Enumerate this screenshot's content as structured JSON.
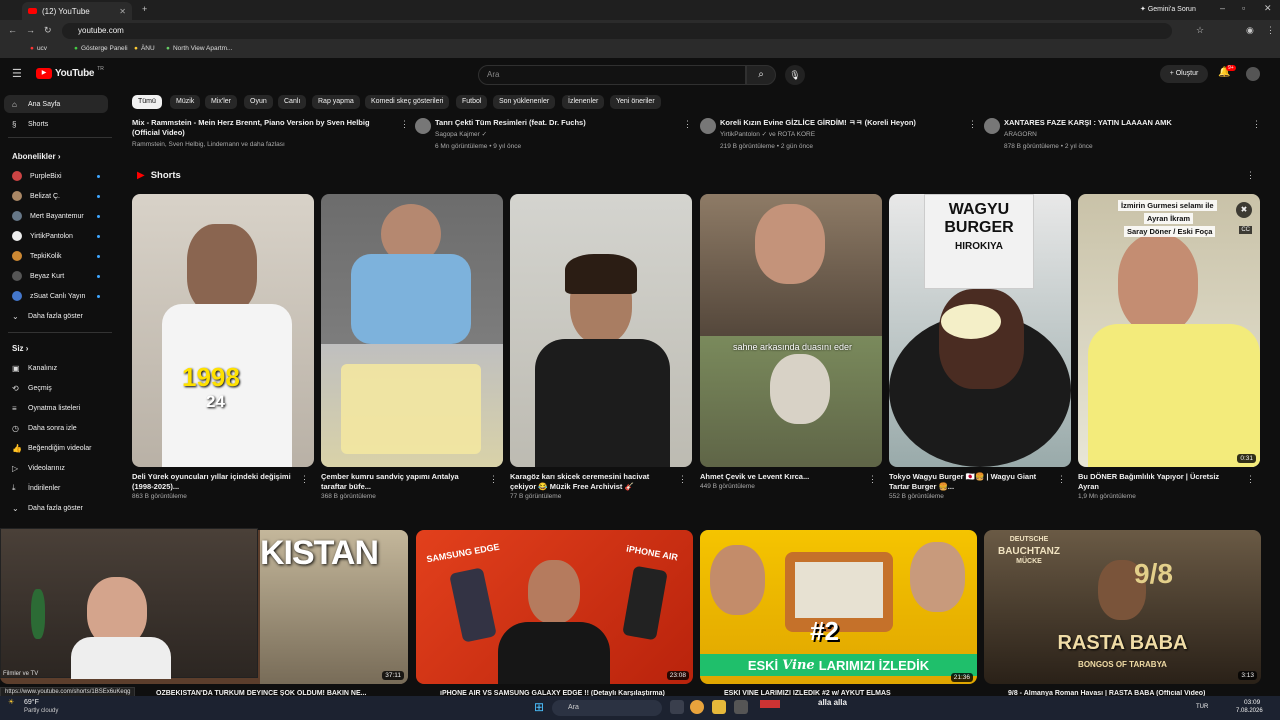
{
  "browser": {
    "tab_title": "(12) YouTube",
    "url": "youtube.com",
    "gemini": "Gemini'a Sorun",
    "bookmarks": [
      "ucv",
      "Gösterge Paneli",
      "ÄNU",
      "North View Apartm..."
    ]
  },
  "header": {
    "logo": "YouTube",
    "logo_sup": "TR",
    "search_placeholder": "Ara",
    "create": "Oluştur",
    "notif": "9+"
  },
  "sidebar": {
    "home": "Ana Sayfa",
    "shorts": "Shorts",
    "subs_head": "Abonelikler",
    "subs": [
      {
        "label": "PurpleBixi",
        "color": "#c44"
      },
      {
        "label": "Belizat Ç.",
        "color": "#a86"
      },
      {
        "label": "Mert Bayantemur",
        "color": "#678"
      },
      {
        "label": "YirtikPantolon",
        "color": "#eee"
      },
      {
        "label": "TepkiKolik",
        "color": "#c83"
      },
      {
        "label": "Beyaz Kurt",
        "color": "#555"
      },
      {
        "label": "zSuat Canlı Yayın",
        "color": "#47c"
      }
    ],
    "more": "Daha fazla göster",
    "you_head": "Siz",
    "you": [
      "Kanalınız",
      "Geçmiş",
      "Oynatma listeleri",
      "Daha sonra izle",
      "Beğendiğim videolar",
      "Videolarınız",
      "İndirilenler",
      "Daha fazla göster"
    ]
  },
  "chips": [
    "Tümü",
    "Müzik",
    "Mix'ler",
    "Oyun",
    "Canlı",
    "Rap yapma",
    "Komedi skeç gösterileri",
    "Futbol",
    "Son yüklenenler",
    "İzlenenler",
    "Yeni öneriler"
  ],
  "toprow": [
    {
      "title": "Mix - Rammstein - Mein Herz Brennt, Piano Version by Sven Helbig",
      "title2": "(Official Video)",
      "meta": "Rammstein, Sven Helbig, Lindemann ve daha fazlası"
    },
    {
      "title": "Tanrı Çekti Tüm Resimleri (feat. Dr. Fuchs)",
      "channel": "Sagopa Kajmer ✓",
      "meta": "6 Mn görüntüleme • 9 yıl önce"
    },
    {
      "title": "Koreli Kızın Evine GİZLİCE GİRDİM! ㅋㅋ (Koreli Heyon)",
      "channel": "YirtikPantolon ✓ ve ROTA KORE",
      "meta": "219 B görüntüleme • 2 gün önce"
    },
    {
      "title": "XANTARES FAZE KARŞI : YATIN LAAAAN AMK",
      "channel": "ARAGORN",
      "meta": "878 B görüntüleme • 2 yıl önce"
    }
  ],
  "shorts_head": "Shorts",
  "shorts": [
    {
      "title": "Deli Yürek oyuncuları yıllar içindeki değişimi (1998-2025)...",
      "views": "863 B görüntüleme",
      "overlay1": "1998",
      "overlay2": "24"
    },
    {
      "title": "Çember kumru sandviç yapımı Antalya taraftar büfe...",
      "views": "368 B görüntüleme"
    },
    {
      "title": "Karagöz karı skicek ceremesini hacivat çekiyor 😂 Müzik Free Archivist 🎸",
      "views": "77 B görüntüleme"
    },
    {
      "title": "Ahmet Çevik ve Levent Kırca...",
      "views": "449 B görüntüleme",
      "caption": "sahne arkasında duasını eder"
    },
    {
      "title": "Tokyo Wagyu Burger 🇯🇵🍔 | Wagyu Giant Tartar Burger 🍔...",
      "views": "552 B görüntüleme",
      "sign1": "WAGYU",
      "sign2": "BURGER",
      "sign3": "HIROKIYA"
    },
    {
      "title": "Bu DÖNER Bağımlılık Yapıyor | Ücretsiz Ayran",
      "views": "1,9 Mn görüntüleme",
      "cap1": "İzmirin Gurmesi selamı ile",
      "cap2": "Ayran İkram",
      "cap3": "Saray Döner / Eski Foça",
      "dur": "0:31"
    }
  ],
  "videos": [
    {
      "title": "ÖZBEKİSTAN'DA TÜRKÜM DEYİNCE ŞOK OLDUM! BAKIN NE...",
      "dur": "37:11",
      "word": "KISTAN",
      "cam_label": "Filmler ve TV"
    },
    {
      "title": "iPHONE AIR VS SAMSUNG GALAXY EDGE !! (Detaylı Karşılaştırma)",
      "dur": "23:08",
      "l1": "SAMSUNG EDGE",
      "l2": "iPHONE AIR"
    },
    {
      "title": "ESKİ VİNE LARIMIZI İZLEDİK #2 w/ AYKUT ELMAS",
      "dur": "21:36",
      "big": "#2",
      "b1": "ESKİ",
      "b2": "Vine",
      "b3": "LARIMIZI İZLEDİK"
    },
    {
      "title": "9/8 - Almanya Roman Havası | RASTA BABA (Official Video)",
      "dur": "3:13",
      "t1": "DEUTSCHE",
      "t2": "BAUCHTANZ",
      "t3": "MÜCKE",
      "t4": "9/8",
      "t5": "RASTA BABA",
      "t6": "BONGOS OF TARABYA"
    }
  ],
  "status_url": "https://www.youtube.com/shorts/1BSEx6uKeqg",
  "taskbar": {
    "temp": "69°F",
    "weather": "Partly cloudy",
    "search": "Ara",
    "lang": "TUR",
    "time": "03:09",
    "date": "7.08.2026",
    "app": "alla alla"
  }
}
